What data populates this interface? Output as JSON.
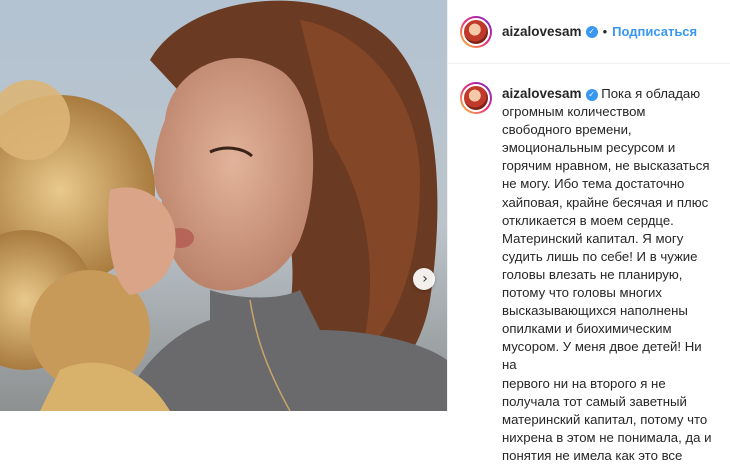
{
  "post": {
    "username": "aizalovesam",
    "follow_label": "Подписаться",
    "dot": "•",
    "verified_glyph": "✓",
    "next_glyph": "›",
    "caption_lines": [
      "Пока я обладаю",
      "огромным количеством",
      "свободного времени,",
      "эмоциональным ресурсом и",
      "горячим нравном, не высказаться",
      "не могу. Ибо тема достаточно",
      "хайповая, крайне бесячая и плюс",
      "откликается в моем сердце.",
      "Материнский капитал. Я могу",
      "судить лишь по себе! И в чужие",
      "головы влезать не планирую,",
      "потому что головы многих",
      "высказывающихся наполнены",
      "опилками и биохимическим",
      "мусором. У меня двое детей! Ни на",
      "первого ни на второго я не",
      "получала тот самый заветный",
      "материнский капитал, потому что",
      "нихрена в этом не понимала, да и",
      "понятия не имела как это все"
    ]
  },
  "colors": {
    "accent": "#3897f0",
    "text": "#262626",
    "border": "#efefef"
  },
  "icons": {
    "verified": "verified-badge-icon",
    "next": "chevron-right-icon"
  }
}
